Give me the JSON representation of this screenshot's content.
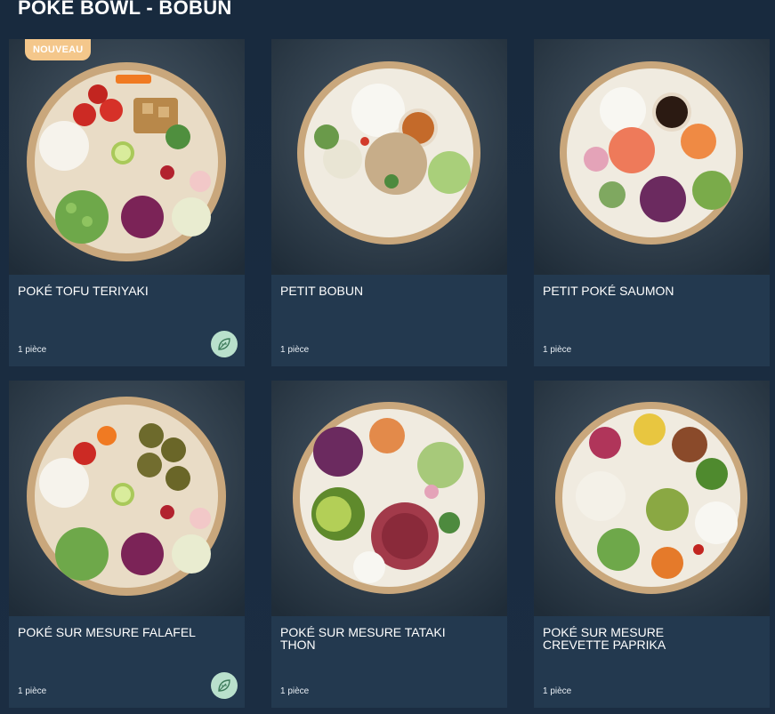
{
  "section": {
    "title": "POKÉ BOWL - BOBUN"
  },
  "colors": {
    "background": "#1a2b3f",
    "card_info": "#23394f",
    "badge": "#f4c78b",
    "veg_icon_bg": "#b9e0cc",
    "veg_icon_fg": "#3d7a5a"
  },
  "products": [
    {
      "name": "POKÉ TOFU TERIYAKI",
      "quantity": "1 pièce",
      "badge": "NOUVEAU",
      "vegetarian": true,
      "icon": "leaf-icon"
    },
    {
      "name": "PETIT BOBUN",
      "quantity": "1 pièce",
      "vegetarian": false
    },
    {
      "name": "PETIT POKÉ SAUMON",
      "quantity": "1 pièce",
      "vegetarian": false
    },
    {
      "name": "POKÉ SUR MESURE FALAFEL",
      "quantity": "1 pièce",
      "vegetarian": true,
      "icon": "leaf-icon"
    },
    {
      "name": "POKÉ SUR MESURE TATAKI THON",
      "quantity": "1 pièce",
      "vegetarian": false
    },
    {
      "name": "POKÉ SUR MESURE CREVETTE PAPRIKA",
      "quantity": "1 pièce",
      "vegetarian": false
    }
  ]
}
